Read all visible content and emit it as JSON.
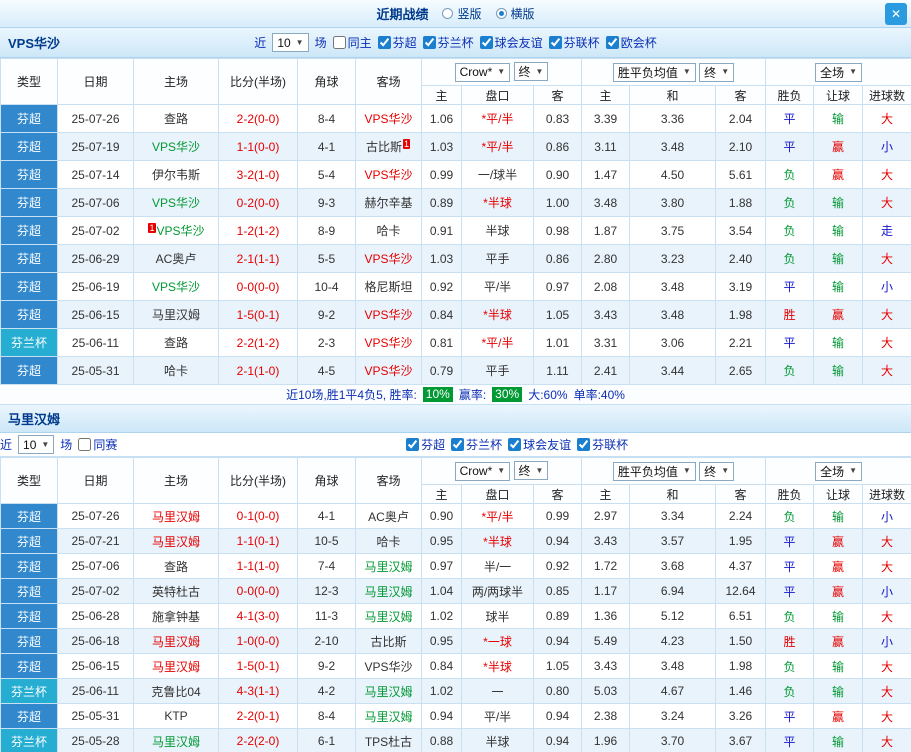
{
  "colors": {
    "red": "#e60000",
    "green": "#009933",
    "blue": "#1515cc",
    "dark": "#333333",
    "league_super_bg": "#3188cc",
    "league_cup_bg": "#25aed2",
    "chip_bg": "#009933",
    "accent_blue": "#2b9be0"
  },
  "header": {
    "title": "近期战绩",
    "vertical": "竖版",
    "horizontal": "横版",
    "close": "✕"
  },
  "table_header": {
    "type": "类型",
    "date": "日期",
    "home": "主场",
    "score": "比分(半场)",
    "corner": "角球",
    "away": "客场",
    "bookmaker": "Crow*",
    "final": "终",
    "avg": "胜平负均值",
    "fulltime": "全场",
    "sub": [
      "主",
      "盘口",
      "客",
      "主",
      "和",
      "客",
      "胜负",
      "让球",
      "进球数"
    ]
  },
  "sections": [
    {
      "team": "VPS华沙",
      "filter": {
        "near": "近",
        "count": "10",
        "unit": "场",
        "venue": "同主",
        "leagues": [
          "芬超",
          "芬兰杯",
          "球会友谊",
          "芬联杯",
          "欧会杯"
        ]
      },
      "summary": {
        "text1": "近10场,胜1平4负5, 胜率:",
        "win_rate": "10%",
        "text2": "赢率:",
        "handicap_rate": "30%",
        "big_rate": "大:60%",
        "single_rate": "单率:40%"
      },
      "rows": [
        {
          "type": "芬超",
          "cup": false,
          "date": "25-07-26",
          "home": {
            "t": "查路",
            "c": "dark"
          },
          "score": "2-2(0-0)",
          "corner": "8-4",
          "away": {
            "t": "VPS华沙",
            "c": "red"
          },
          "o1": "1.06",
          "hc": {
            "t": "*平/半",
            "c": "red"
          },
          "o2": "0.83",
          "m1": "3.39",
          "m2": "3.36",
          "m3": "2.04",
          "r1": {
            "t": "平",
            "c": "blue"
          },
          "r2": {
            "t": "输",
            "c": "green"
          },
          "r3": {
            "t": "大",
            "c": "red"
          }
        },
        {
          "type": "芬超",
          "cup": false,
          "date": "25-07-19",
          "home": {
            "t": "VPS华沙",
            "c": "green"
          },
          "score": "1-1(0-0)",
          "corner": "4-1",
          "away": {
            "t": "古比斯",
            "c": "dark",
            "badge": "1",
            "bpos": "after"
          },
          "o1": "1.03",
          "hc": {
            "t": "*平/半",
            "c": "red"
          },
          "o2": "0.86",
          "m1": "3.11",
          "m2": "3.48",
          "m3": "2.10",
          "r1": {
            "t": "平",
            "c": "blue"
          },
          "r2": {
            "t": "赢",
            "c": "red"
          },
          "r3": {
            "t": "小",
            "c": "blue"
          }
        },
        {
          "type": "芬超",
          "cup": false,
          "date": "25-07-14",
          "home": {
            "t": "伊尔韦斯",
            "c": "dark"
          },
          "score": "3-2(1-0)",
          "corner": "5-4",
          "away": {
            "t": "VPS华沙",
            "c": "red"
          },
          "o1": "0.99",
          "hc": {
            "t": "一/球半",
            "c": "dark"
          },
          "o2": "0.90",
          "m1": "1.47",
          "m2": "4.50",
          "m3": "5.61",
          "r1": {
            "t": "负",
            "c": "green"
          },
          "r2": {
            "t": "赢",
            "c": "red"
          },
          "r3": {
            "t": "大",
            "c": "red"
          }
        },
        {
          "type": "芬超",
          "cup": false,
          "date": "25-07-06",
          "home": {
            "t": "VPS华沙",
            "c": "green"
          },
          "score": "0-2(0-0)",
          "corner": "9-3",
          "away": {
            "t": "赫尔辛基",
            "c": "dark"
          },
          "o1": "0.89",
          "hc": {
            "t": "*半球",
            "c": "red"
          },
          "o2": "1.00",
          "m1": "3.48",
          "m2": "3.80",
          "m3": "1.88",
          "r1": {
            "t": "负",
            "c": "green"
          },
          "r2": {
            "t": "输",
            "c": "green"
          },
          "r3": {
            "t": "大",
            "c": "red"
          }
        },
        {
          "type": "芬超",
          "cup": false,
          "date": "25-07-02",
          "home": {
            "t": "VPS华沙",
            "c": "green",
            "badge": "1",
            "bpos": "before"
          },
          "score": "1-2(1-2)",
          "corner": "8-9",
          "away": {
            "t": "哈卡",
            "c": "dark"
          },
          "o1": "0.91",
          "hc": {
            "t": "半球",
            "c": "dark"
          },
          "o2": "0.98",
          "m1": "1.87",
          "m2": "3.75",
          "m3": "3.54",
          "r1": {
            "t": "负",
            "c": "green"
          },
          "r2": {
            "t": "输",
            "c": "green"
          },
          "r3": {
            "t": "走",
            "c": "blue"
          }
        },
        {
          "type": "芬超",
          "cup": false,
          "date": "25-06-29",
          "home": {
            "t": "AC奥卢",
            "c": "dark"
          },
          "score": "2-1(1-1)",
          "corner": "5-5",
          "away": {
            "t": "VPS华沙",
            "c": "red"
          },
          "o1": "1.03",
          "hc": {
            "t": "平手",
            "c": "dark"
          },
          "o2": "0.86",
          "m1": "2.80",
          "m2": "3.23",
          "m3": "2.40",
          "r1": {
            "t": "负",
            "c": "green"
          },
          "r2": {
            "t": "输",
            "c": "green"
          },
          "r3": {
            "t": "大",
            "c": "red"
          }
        },
        {
          "type": "芬超",
          "cup": false,
          "date": "25-06-19",
          "home": {
            "t": "VPS华沙",
            "c": "green"
          },
          "score": "0-0(0-0)",
          "corner": "10-4",
          "away": {
            "t": "格尼斯坦",
            "c": "dark"
          },
          "o1": "0.92",
          "hc": {
            "t": "平/半",
            "c": "dark"
          },
          "o2": "0.97",
          "m1": "2.08",
          "m2": "3.48",
          "m3": "3.19",
          "r1": {
            "t": "平",
            "c": "blue"
          },
          "r2": {
            "t": "输",
            "c": "green"
          },
          "r3": {
            "t": "小",
            "c": "blue"
          }
        },
        {
          "type": "芬超",
          "cup": false,
          "date": "25-06-15",
          "home": {
            "t": "马里汉姆",
            "c": "dark"
          },
          "score": "1-5(0-1)",
          "corner": "9-2",
          "away": {
            "t": "VPS华沙",
            "c": "red"
          },
          "o1": "0.84",
          "hc": {
            "t": "*半球",
            "c": "red"
          },
          "o2": "1.05",
          "m1": "3.43",
          "m2": "3.48",
          "m3": "1.98",
          "r1": {
            "t": "胜",
            "c": "red"
          },
          "r2": {
            "t": "赢",
            "c": "red"
          },
          "r3": {
            "t": "大",
            "c": "red"
          }
        },
        {
          "type": "芬兰杯",
          "cup": true,
          "date": "25-06-11",
          "home": {
            "t": "查路",
            "c": "dark"
          },
          "score": "2-2(1-2)",
          "corner": "2-3",
          "away": {
            "t": "VPS华沙",
            "c": "red"
          },
          "o1": "0.81",
          "hc": {
            "t": "*平/半",
            "c": "red"
          },
          "o2": "1.01",
          "m1": "3.31",
          "m2": "3.06",
          "m3": "2.21",
          "r1": {
            "t": "平",
            "c": "blue"
          },
          "r2": {
            "t": "输",
            "c": "green"
          },
          "r3": {
            "t": "大",
            "c": "red"
          }
        },
        {
          "type": "芬超",
          "cup": false,
          "date": "25-05-31",
          "home": {
            "t": "哈卡",
            "c": "dark"
          },
          "score": "2-1(1-0)",
          "corner": "4-5",
          "away": {
            "t": "VPS华沙",
            "c": "red"
          },
          "o1": "0.79",
          "hc": {
            "t": "平手",
            "c": "dark"
          },
          "o2": "1.11",
          "m1": "2.41",
          "m2": "3.44",
          "m3": "2.65",
          "r1": {
            "t": "负",
            "c": "green"
          },
          "r2": {
            "t": "输",
            "c": "green"
          },
          "r3": {
            "t": "大",
            "c": "red"
          }
        }
      ]
    },
    {
      "team": "马里汉姆",
      "filter": {
        "near": "近",
        "count": "10",
        "unit": "场",
        "venue": "同赛",
        "leagues": [
          "芬超",
          "芬兰杯",
          "球会友谊",
          "芬联杯"
        ]
      },
      "rows": [
        {
          "type": "芬超",
          "cup": false,
          "date": "25-07-26",
          "home": {
            "t": "马里汉姆",
            "c": "red"
          },
          "score": "0-1(0-0)",
          "corner": "4-1",
          "away": {
            "t": "AC奥卢",
            "c": "dark"
          },
          "o1": "0.90",
          "hc": {
            "t": "*平/半",
            "c": "red"
          },
          "o2": "0.99",
          "m1": "2.97",
          "m2": "3.34",
          "m3": "2.24",
          "r1": {
            "t": "负",
            "c": "green"
          },
          "r2": {
            "t": "输",
            "c": "green"
          },
          "r3": {
            "t": "小",
            "c": "blue"
          }
        },
        {
          "type": "芬超",
          "cup": false,
          "date": "25-07-21",
          "home": {
            "t": "马里汉姆",
            "c": "red"
          },
          "score": "1-1(0-1)",
          "corner": "10-5",
          "away": {
            "t": "哈卡",
            "c": "dark"
          },
          "o1": "0.95",
          "hc": {
            "t": "*半球",
            "c": "red"
          },
          "o2": "0.94",
          "m1": "3.43",
          "m2": "3.57",
          "m3": "1.95",
          "r1": {
            "t": "平",
            "c": "blue"
          },
          "r2": {
            "t": "赢",
            "c": "red"
          },
          "r3": {
            "t": "大",
            "c": "red"
          }
        },
        {
          "type": "芬超",
          "cup": false,
          "date": "25-07-06",
          "home": {
            "t": "查路",
            "c": "dark"
          },
          "score": "1-1(1-0)",
          "corner": "7-4",
          "away": {
            "t": "马里汉姆",
            "c": "green"
          },
          "o1": "0.97",
          "hc": {
            "t": "半/一",
            "c": "dark"
          },
          "o2": "0.92",
          "m1": "1.72",
          "m2": "3.68",
          "m3": "4.37",
          "r1": {
            "t": "平",
            "c": "blue"
          },
          "r2": {
            "t": "赢",
            "c": "red"
          },
          "r3": {
            "t": "大",
            "c": "red"
          }
        },
        {
          "type": "芬超",
          "cup": false,
          "date": "25-07-02",
          "home": {
            "t": "英特杜古",
            "c": "dark"
          },
          "score": "0-0(0-0)",
          "corner": "12-3",
          "away": {
            "t": "马里汉姆",
            "c": "green"
          },
          "o1": "1.04",
          "hc": {
            "t": "两/两球半",
            "c": "dark"
          },
          "o2": "0.85",
          "m1": "1.17",
          "m2": "6.94",
          "m3": "12.64",
          "r1": {
            "t": "平",
            "c": "blue"
          },
          "r2": {
            "t": "赢",
            "c": "red"
          },
          "r3": {
            "t": "小",
            "c": "blue"
          }
        },
        {
          "type": "芬超",
          "cup": false,
          "date": "25-06-28",
          "home": {
            "t": "施拿钟基",
            "c": "dark"
          },
          "score": "4-1(3-0)",
          "corner": "11-3",
          "away": {
            "t": "马里汉姆",
            "c": "green"
          },
          "o1": "1.02",
          "hc": {
            "t": "球半",
            "c": "dark"
          },
          "o2": "0.89",
          "m1": "1.36",
          "m2": "5.12",
          "m3": "6.51",
          "r1": {
            "t": "负",
            "c": "green"
          },
          "r2": {
            "t": "输",
            "c": "green"
          },
          "r3": {
            "t": "大",
            "c": "red"
          }
        },
        {
          "type": "芬超",
          "cup": false,
          "date": "25-06-18",
          "home": {
            "t": "马里汉姆",
            "c": "red"
          },
          "score": "1-0(0-0)",
          "corner": "2-10",
          "away": {
            "t": "古比斯",
            "c": "dark"
          },
          "o1": "0.95",
          "hc": {
            "t": "*一球",
            "c": "red"
          },
          "o2": "0.94",
          "m1": "5.49",
          "m2": "4.23",
          "m3": "1.50",
          "r1": {
            "t": "胜",
            "c": "red"
          },
          "r2": {
            "t": "赢",
            "c": "red"
          },
          "r3": {
            "t": "小",
            "c": "blue"
          }
        },
        {
          "type": "芬超",
          "cup": false,
          "date": "25-06-15",
          "home": {
            "t": "马里汉姆",
            "c": "red"
          },
          "score": "1-5(0-1)",
          "corner": "9-2",
          "away": {
            "t": "VPS华沙",
            "c": "dark"
          },
          "o1": "0.84",
          "hc": {
            "t": "*半球",
            "c": "red"
          },
          "o2": "1.05",
          "m1": "3.43",
          "m2": "3.48",
          "m3": "1.98",
          "r1": {
            "t": "负",
            "c": "green"
          },
          "r2": {
            "t": "输",
            "c": "green"
          },
          "r3": {
            "t": "大",
            "c": "red"
          }
        },
        {
          "type": "芬兰杯",
          "cup": true,
          "date": "25-06-11",
          "home": {
            "t": "克鲁比04",
            "c": "dark"
          },
          "score": "4-3(1-1)",
          "corner": "4-2",
          "away": {
            "t": "马里汉姆",
            "c": "green"
          },
          "o1": "1.02",
          "hc": {
            "t": "一",
            "c": "dark"
          },
          "o2": "0.80",
          "m1": "5.03",
          "m2": "4.67",
          "m3": "1.46",
          "r1": {
            "t": "负",
            "c": "green"
          },
          "r2": {
            "t": "输",
            "c": "green"
          },
          "r3": {
            "t": "大",
            "c": "red"
          }
        },
        {
          "type": "芬超",
          "cup": false,
          "date": "25-05-31",
          "home": {
            "t": "KTP",
            "c": "dark"
          },
          "score": "2-2(0-1)",
          "corner": "8-4",
          "away": {
            "t": "马里汉姆",
            "c": "green"
          },
          "o1": "0.94",
          "hc": {
            "t": "平/半",
            "c": "dark"
          },
          "o2": "0.94",
          "m1": "2.38",
          "m2": "3.24",
          "m3": "3.26",
          "r1": {
            "t": "平",
            "c": "blue"
          },
          "r2": {
            "t": "赢",
            "c": "red"
          },
          "r3": {
            "t": "大",
            "c": "red"
          }
        },
        {
          "type": "芬兰杯",
          "cup": true,
          "date": "25-05-28",
          "home": {
            "t": "马里汉姆",
            "c": "green"
          },
          "score": "2-2(2-0)",
          "corner": "6-1",
          "away": {
            "t": "TPS杜古",
            "c": "dark"
          },
          "o1": "0.88",
          "hc": {
            "t": "半球",
            "c": "dark"
          },
          "o2": "0.94",
          "m1": "1.96",
          "m2": "3.70",
          "m3": "3.67",
          "r1": {
            "t": "平",
            "c": "blue"
          },
          "r2": {
            "t": "输",
            "c": "green"
          },
          "r3": {
            "t": "大",
            "c": "red"
          }
        }
      ]
    }
  ]
}
